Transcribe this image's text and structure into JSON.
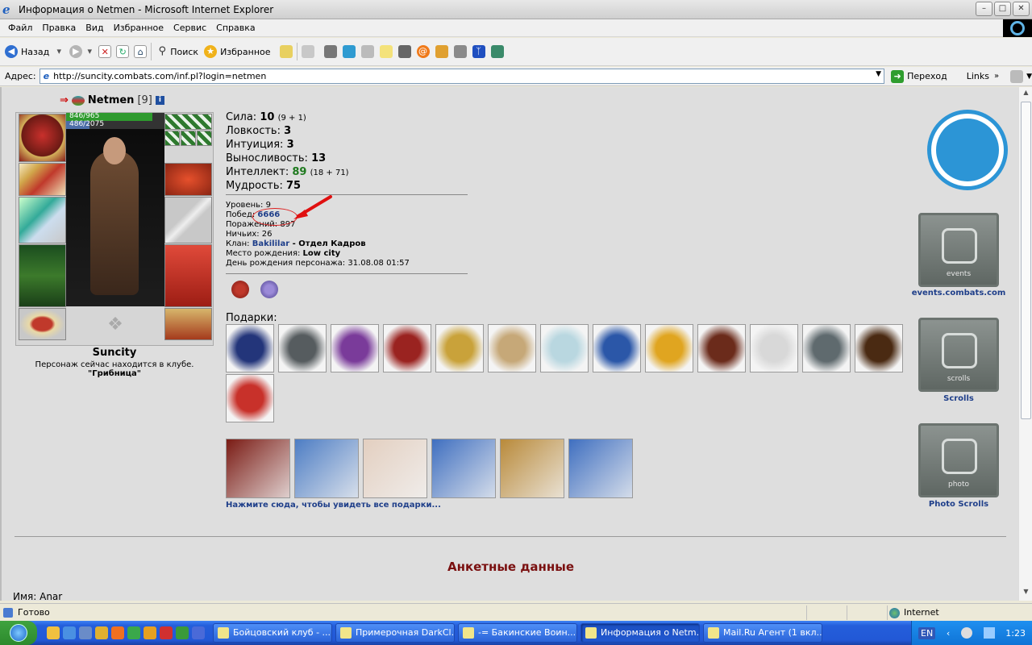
{
  "window": {
    "title": "Информация о Netmen - Microsoft Internet Explorer"
  },
  "menu": [
    "Файл",
    "Правка",
    "Вид",
    "Избранное",
    "Сервис",
    "Справка"
  ],
  "toolbar": {
    "back": "Назад",
    "search": "Поиск",
    "favorites": "Избранное"
  },
  "address": {
    "label": "Адрес:",
    "url": "http://suncity.combats.com/inf.pl?login=netmen",
    "go": "Переход",
    "links": "Links"
  },
  "player": {
    "name": "Netmen",
    "level": "[9]",
    "hp": "846/965",
    "hp_fraction": 0.877,
    "mana": "486/2075",
    "mana_fraction": 0.234,
    "city": "Suncity",
    "location_text": "Персонаж сейчас находится в клубе.",
    "location_place": "\"Грибница\""
  },
  "stats": [
    {
      "label": "Сила: ",
      "value": "10",
      "extra": "(9 + 1)",
      "green": false
    },
    {
      "label": "Ловкость: ",
      "value": "3",
      "extra": "",
      "green": false
    },
    {
      "label": "Интуиция: ",
      "value": "3",
      "extra": "",
      "green": false
    },
    {
      "label": "Выносливость: ",
      "value": "13",
      "extra": "",
      "green": false
    },
    {
      "label": "Интеллект: ",
      "value": "89",
      "extra": "(18 + 71)",
      "green": true
    },
    {
      "label": "Мудрость: ",
      "value": "75",
      "extra": "",
      "green": false
    }
  ],
  "info": {
    "level_label": "Уровень: ",
    "level_value": "9",
    "wins_label": "Побед: ",
    "wins_value": "6666",
    "losses_label": "Поражений: ",
    "losses_value": "897",
    "draws_label": "Ничьих: ",
    "draws_value": "26",
    "clan_label": "Клан: ",
    "clan_value": "Bakililar",
    "clan_dept": " - Отдел Кадров",
    "birth_place_label": "Место рождения: ",
    "birth_place_value": "Low city",
    "birthday_label": "День рождения персонажа: ",
    "birthday_value": "31.08.08 01:57"
  },
  "gifts_label": "Подарки:",
  "gifts_more": "Нажмите сюда, чтобы увидеть все подарки...",
  "gift_colors": [
    "#23357a",
    "#565c5f",
    "#7a3b9a",
    "#9a2320",
    "#c9a23a",
    "#c6a878",
    "#b9d7e0",
    "#2b57a8",
    "#e0a520",
    "#6b2b1b",
    "#d8d8d8",
    "#5f6a6e",
    "#4a2a12",
    "#c8312a"
  ],
  "card_colors": [
    "#7a1b14",
    "#4d7dc4",
    "#e3cfc0",
    "#3f6fc0",
    "#b98a3a",
    "#3f6fc0"
  ],
  "section_title": "Анкетные данные",
  "name_row": {
    "label": "Имя: ",
    "value": "Anar"
  },
  "side": {
    "events_link": "events.combats.com",
    "events_text": "events",
    "scrolls_link": "Scrolls",
    "scrolls_text": "scrolls",
    "photo_link": "Photo Scrolls",
    "photo_text": "photo"
  },
  "status": {
    "text": "Готово",
    "zone": "Internet"
  },
  "taskbar": {
    "tasks": [
      {
        "label": "Бойцовский клуб - ...",
        "active": false
      },
      {
        "label": "Примерочная DarkCl...",
        "active": false
      },
      {
        "label": "-= Бакинские Воин...",
        "active": false
      },
      {
        "label": "Информация о Netm...",
        "active": true
      },
      {
        "label": "Mail.Ru Агент (1 вкл...",
        "active": false
      }
    ],
    "lang": "EN",
    "clock": "1:23"
  }
}
